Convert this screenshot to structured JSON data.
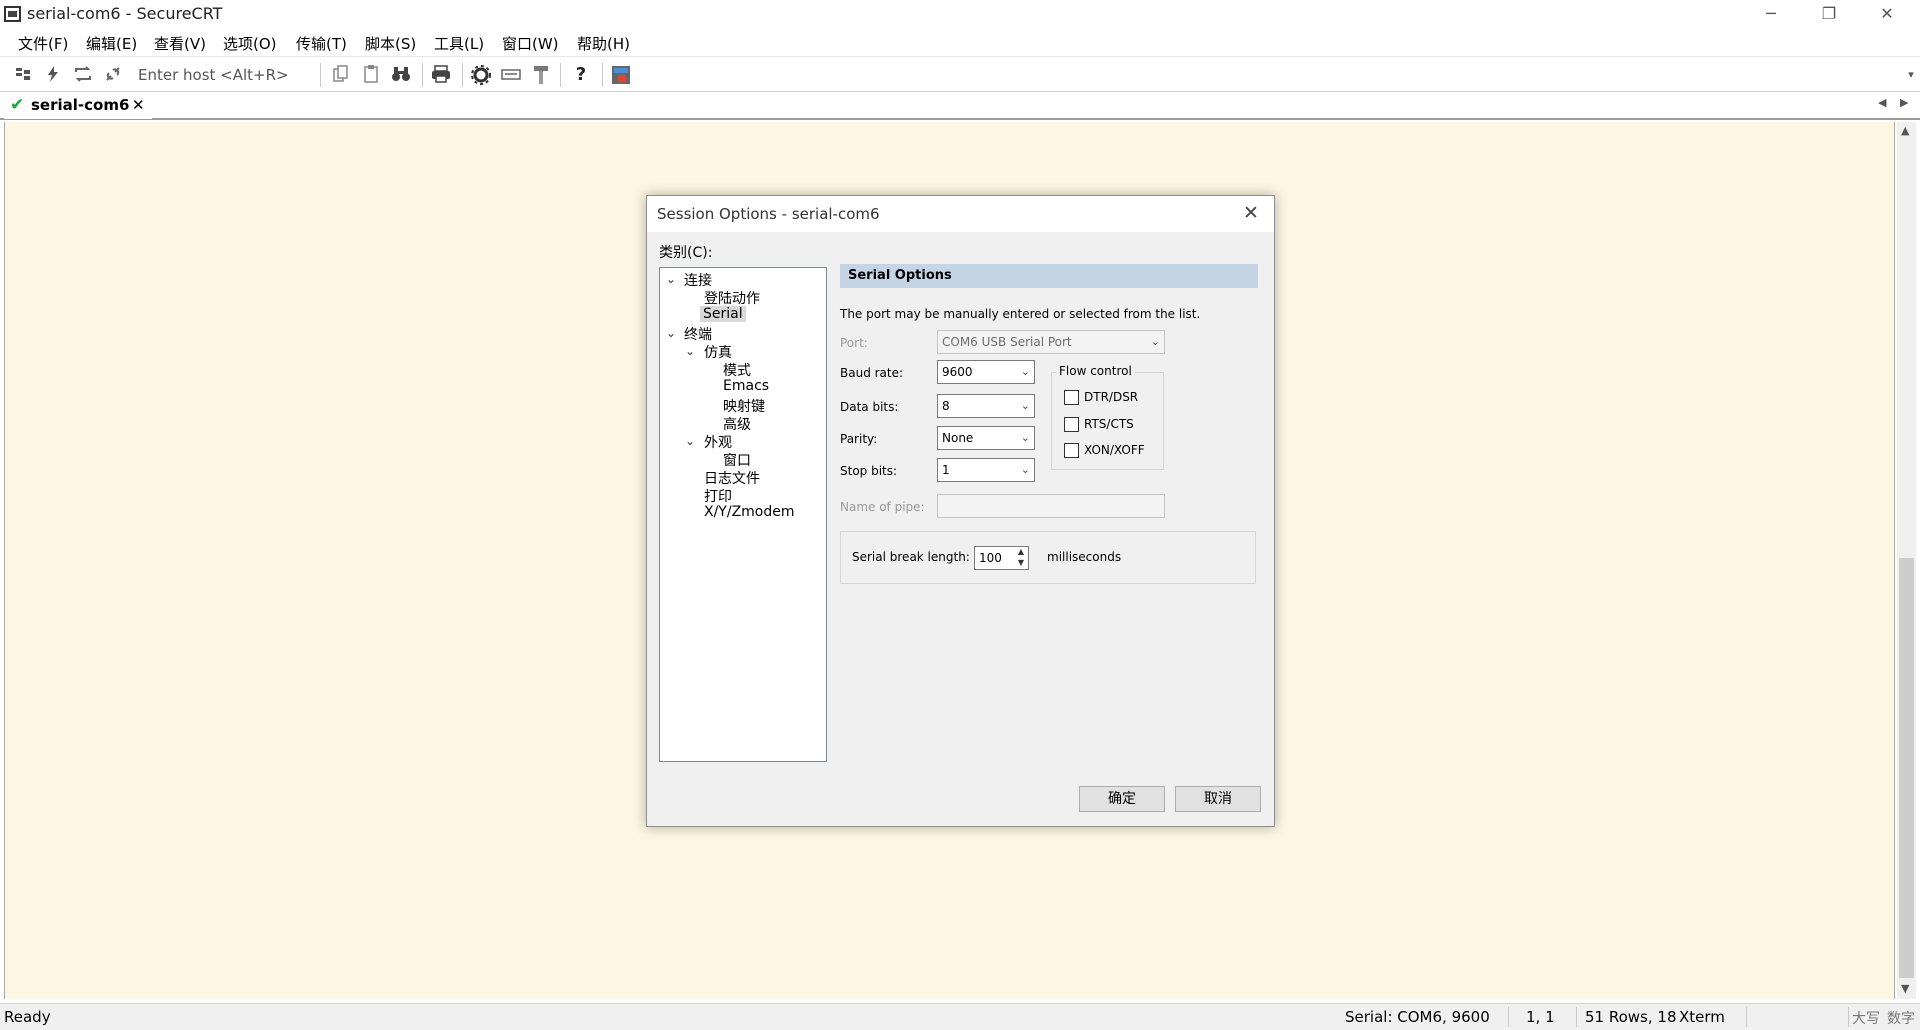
{
  "window": {
    "title": "serial-com6 - SecureCRT",
    "minimize": "─",
    "restore": "❐",
    "close": "✕"
  },
  "menu": [
    "文件(F)",
    "编辑(E)",
    "查看(V)",
    "选项(O)",
    "传输(T)",
    "脚本(S)",
    "工具(L)",
    "窗口(W)",
    "帮助(H)"
  ],
  "toolbar": {
    "host_placeholder": "Enter host <Alt+R>",
    "icons": [
      "connect-icon",
      "quick-connect-icon",
      "reconnect-icon",
      "disconnect-icon",
      "copy-icon",
      "paste-icon",
      "find-icon",
      "print-icon",
      "settings-icon",
      "keymap-icon",
      "sftp-icon",
      "help-icon",
      "screen-icon"
    ],
    "overflow": "▾"
  },
  "tab": {
    "label": "serial-com6",
    "check": "✔",
    "close": "✕",
    "left_arrow": "◀",
    "right_arrow": "▶"
  },
  "terminal": {
    "bg": "#fdf6e3",
    "scroll_up": "▲",
    "scroll_down": "▼"
  },
  "status": {
    "ready": "Ready",
    "serial": "Serial: COM6, 9600",
    "position": "1,   1",
    "size": "51 Rows, 18",
    "term": "Xterm",
    "caps": "大写",
    "num": "数字"
  },
  "dialog": {
    "title": "Session Options - serial-com6",
    "close": "✕",
    "category_label": "类别(C):",
    "tree": [
      {
        "label": "连接",
        "toggle": "⌄"
      },
      {
        "label": "登陆动作"
      },
      {
        "label": "Serial",
        "selected": true
      },
      {
        "label": "终端",
        "toggle": "⌄"
      },
      {
        "label": "仿真",
        "toggle": "⌄"
      },
      {
        "label": "模式"
      },
      {
        "label": "Emacs"
      },
      {
        "label": "映射键"
      },
      {
        "label": "高级"
      },
      {
        "label": "外观",
        "toggle": "⌄"
      },
      {
        "label": "窗口"
      },
      {
        "label": "日志文件"
      },
      {
        "label": "打印"
      },
      {
        "label": "X/Y/Zmodem"
      }
    ],
    "section": "Serial Options",
    "description": "The port may be manually entered or selected from the list.",
    "port_label": "Port:",
    "port_value": "COM6 USB Serial Port",
    "baud_label": "Baud rate:",
    "baud_value": "9600",
    "databits_label": "Data bits:",
    "databits_value": "8",
    "parity_label": "Parity:",
    "parity_value": "None",
    "stopbits_label": "Stop bits:",
    "stopbits_value": "1",
    "pipe_label": "Name of pipe:",
    "pipe_value": "",
    "flow_title": "Flow control",
    "flow": [
      {
        "label": "DTR/DSR",
        "checked": false
      },
      {
        "label": "RTS/CTS",
        "checked": false
      },
      {
        "label": "XON/XOFF",
        "checked": false
      }
    ],
    "break_label": "Serial break length:",
    "break_value": "100",
    "break_unit": "milliseconds",
    "ok": "确定",
    "cancel": "取消",
    "arrow": "⌄",
    "spin_up": "▲",
    "spin_down": "▼"
  }
}
